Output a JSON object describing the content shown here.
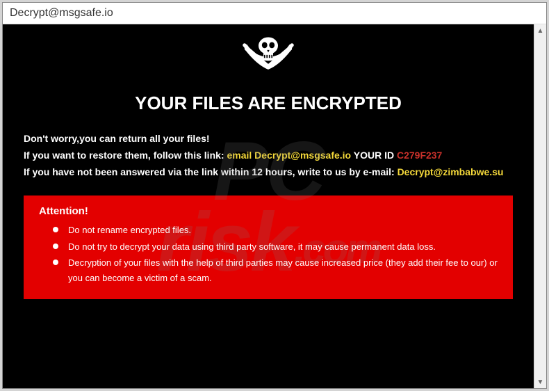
{
  "window": {
    "title": "Decrypt@msgsafe.io"
  },
  "main": {
    "heading": "YOUR FILES ARE ENCRYPTED",
    "line1": "Don't worry,you can return all your files!",
    "line2_prefix": "If you want to restore them, follow this link: ",
    "email_label": "email ",
    "email1": "Decrypt@msgsafe.io",
    "your_id_label": "  YOUR ID ",
    "user_id": "C279F237",
    "line3_prefix": "If you have not been answered via the link within 12 hours, write to us by e-mail: ",
    "email2": "Decrypt@zimbabwe.su"
  },
  "attention": {
    "title": "Attention!",
    "bullets": [
      "Do not rename encrypted files.",
      "Do not try to decrypt your data using third party software, it may cause permanent data loss.",
      "Decryption of your files with the help of third parties may cause increased price (they add their fee to our) or you can become a victim of a scam."
    ]
  },
  "watermark": {
    "line1": "PC",
    "line2": "risk",
    "dot": ".com"
  },
  "icons": {
    "skull": "skull-crossed-swords",
    "scroll_up": "▲",
    "scroll_down": "▼"
  }
}
